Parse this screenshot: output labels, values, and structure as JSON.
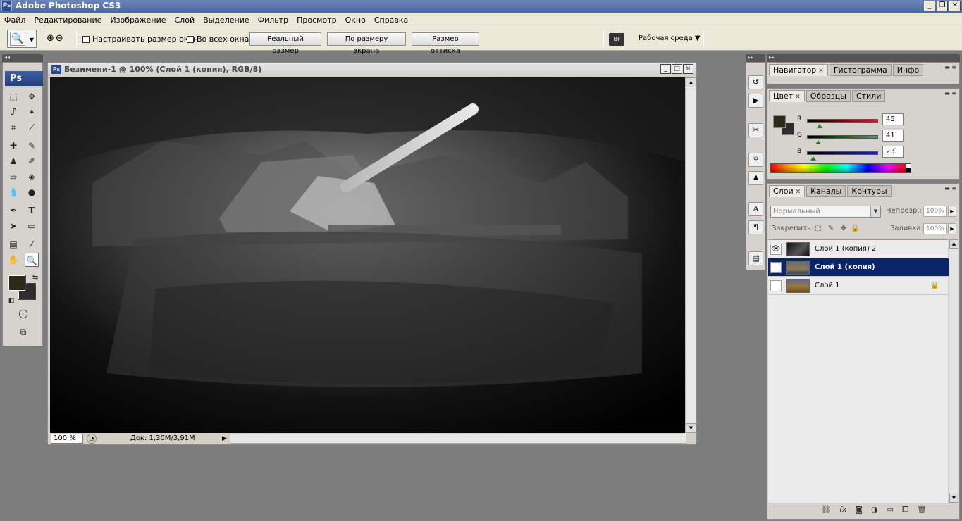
{
  "app": {
    "title": "Adobe Photoshop CS3",
    "logo": "Ps"
  },
  "window_controls": {
    "minimize": "_",
    "maximize": "❐",
    "close": "✕"
  },
  "menu": [
    "Файл",
    "Редактирование",
    "Изображение",
    "Слой",
    "Выделение",
    "Фильтр",
    "Просмотр",
    "Окно",
    "Справка"
  ],
  "options": {
    "tool_icon": "zoom-tool-icon",
    "resize_windows_label": "Настраивать размер окон",
    "all_windows_label": "Во всех окнах",
    "actual_pixels": "Реальный размер",
    "fit_screen": "По размеру экрана",
    "print_size": "Размер оттиска",
    "bridge_label": "Br",
    "workspace": "Рабочая среда"
  },
  "toolbox": {
    "logo": "Ps"
  },
  "document": {
    "title": "Безимени-1 @ 100% (Слой 1 (копия), RGB/8)",
    "zoom": "100 %",
    "doc_info": "Док: 1,30M/3,91M"
  },
  "navigator_panel": {
    "tabs": [
      "Навигатор",
      "Гистограмма",
      "Инфо"
    ]
  },
  "color_panel": {
    "tabs": [
      "Цвет",
      "Образцы",
      "Стили"
    ],
    "fg_color": "#2d2917",
    "bg_color": "#2d2d2d",
    "channels": [
      {
        "label": "R",
        "value": "45",
        "color": "#cc2222",
        "fraction": 0.176
      },
      {
        "label": "G",
        "value": "41",
        "color": "#22bb22",
        "fraction": 0.161
      },
      {
        "label": "B",
        "value": "23",
        "color": "#2222bb",
        "fraction": 0.09
      }
    ]
  },
  "layers_panel": {
    "tabs": [
      "Слои",
      "Каналы",
      "Контуры"
    ],
    "blend_mode": "Нормальный",
    "opacity_label": "Непрозр.:",
    "opacity_value": "100%",
    "lock_label": "Закрепить:",
    "fill_label": "Заливка:",
    "fill_value": "100%",
    "layers": [
      {
        "name": "Слой 1 (копия) 2",
        "visible": true,
        "selected": false,
        "locked": false
      },
      {
        "name": "Слой 1 (копия)",
        "visible": false,
        "selected": true,
        "locked": false
      },
      {
        "name": "Слой 1",
        "visible": false,
        "selected": false,
        "locked": true
      }
    ]
  }
}
